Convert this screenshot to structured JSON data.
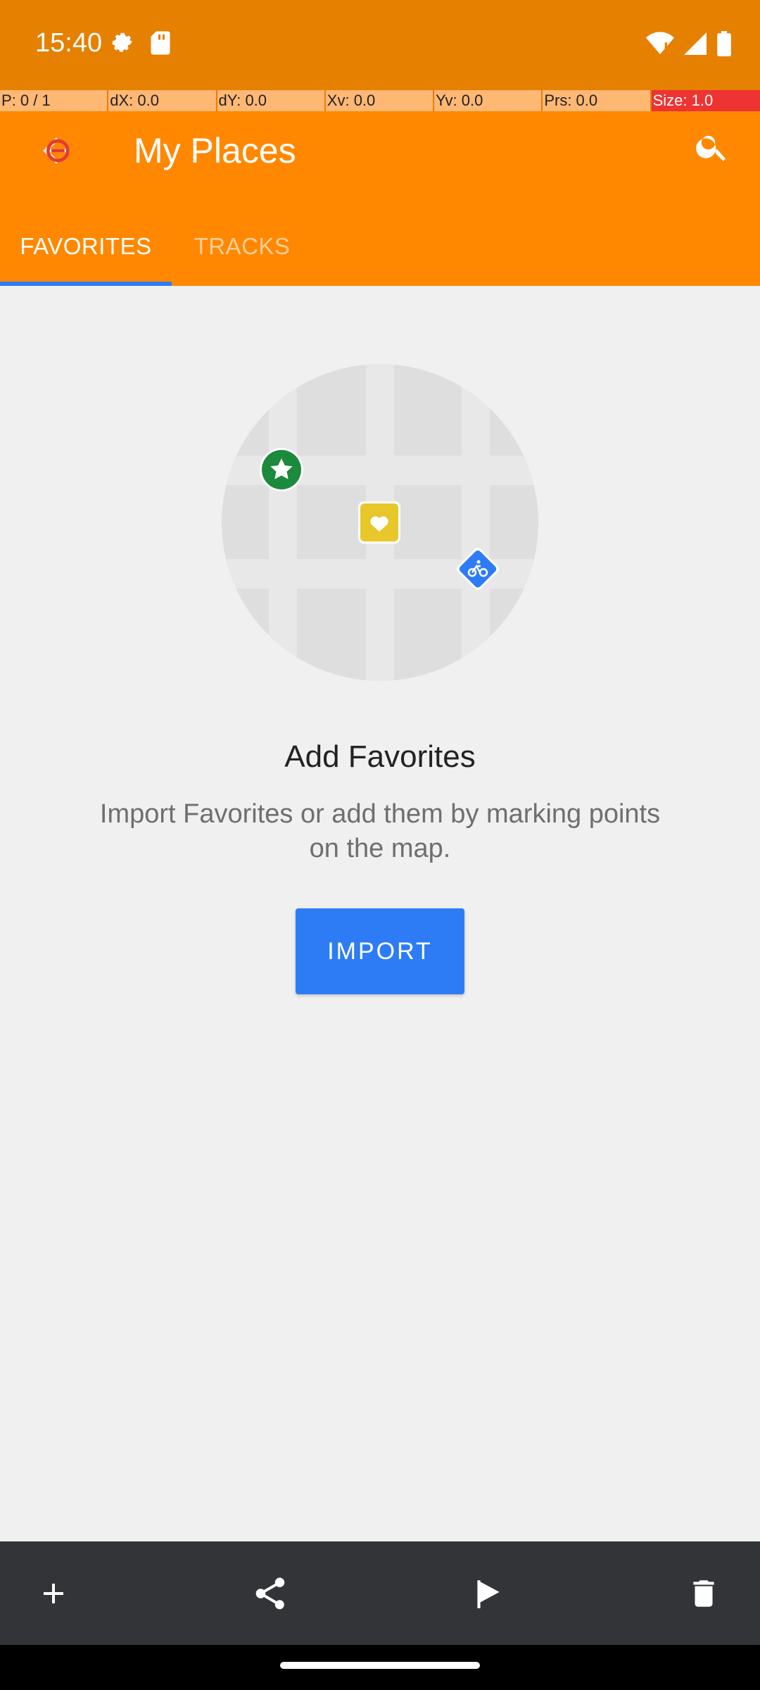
{
  "status": {
    "time": "15:40"
  },
  "pointer": {
    "p": "P: 0 / 1",
    "dx": "dX: 0.0",
    "dy": "dY: 0.0",
    "xv": "Xv: 0.0",
    "yv": "Yv: 0.0",
    "prs": "Prs: 0.0",
    "size": "Size: 1.0"
  },
  "app_bar": {
    "title": "My Places",
    "tabs": [
      {
        "label": "FAVORITES",
        "active": true
      },
      {
        "label": "TRACKS",
        "active": false
      }
    ]
  },
  "empty_state": {
    "title": "Add Favorites",
    "description": "Import Favorites or add them by marking points on the map.",
    "import_label": "IMPORT"
  },
  "bottom_actions": [
    {
      "icon": "add-icon"
    },
    {
      "icon": "share-icon"
    },
    {
      "icon": "flag-icon"
    },
    {
      "icon": "delete-icon"
    }
  ],
  "colors": {
    "status_bar": "#e68000",
    "app_bar": "#ff8800",
    "accent": "#2d7cf6",
    "bottom_bar": "#323437"
  }
}
